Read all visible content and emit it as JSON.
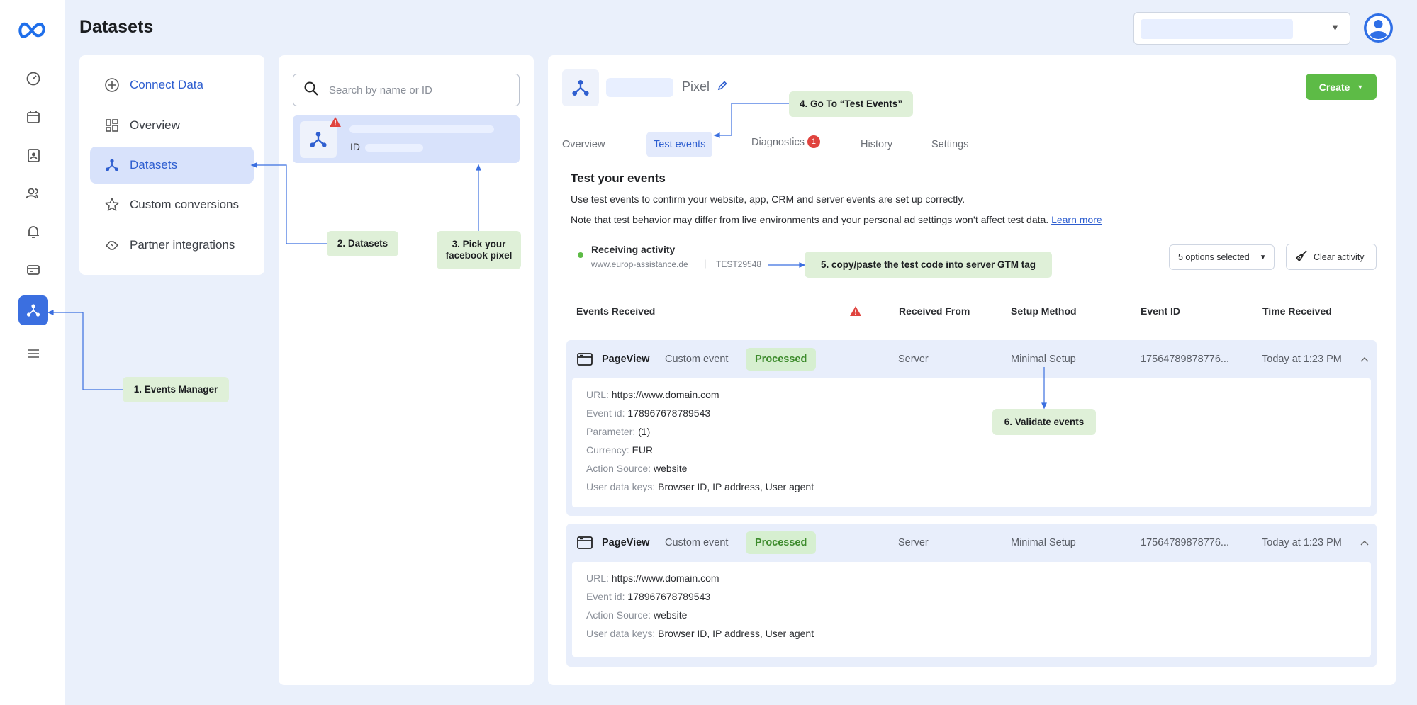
{
  "header": {
    "title": "Datasets"
  },
  "side_menu": {
    "items": [
      {
        "label": "Connect Data"
      },
      {
        "label": "Overview"
      },
      {
        "label": "Datasets"
      },
      {
        "label": "Custom conversions"
      },
      {
        "label": "Partner integrations"
      }
    ]
  },
  "middle": {
    "search_placeholder": "Search by name or ID",
    "pixel_item": {
      "id_label": "ID"
    }
  },
  "main": {
    "pixel_label": "Pixel",
    "create_label": "Create",
    "tabs": [
      {
        "label": "Overview"
      },
      {
        "label": "Test events"
      },
      {
        "label": "Diagnostics",
        "badge": "1"
      },
      {
        "label": "History"
      },
      {
        "label": "Settings"
      }
    ],
    "section_title": "Test your events",
    "desc1": "Use test events to confirm your website, app, CRM and server events are set up correctly.",
    "desc2": "Note that test behavior may differ from live environments and your  personal ad settings won’t affect test data.",
    "learn_more": "Learn more",
    "activity": {
      "status": "Receiving activity",
      "domain": "www.europ-assistance.de",
      "separator": "|",
      "test_code": "TEST29548"
    },
    "options_label": "5 options selected",
    "clear_label": "Clear activity",
    "table_headers": {
      "events_received": "Events Received",
      "received_from": "Received From",
      "setup_method": "Setup Method",
      "event_id": "Event ID",
      "time_received": "Time Received"
    },
    "events": [
      {
        "name": "PageView",
        "type": "Custom event",
        "status": "Processed",
        "from": "Server",
        "method": "Minimal Setup",
        "event_id": "17564789878776...",
        "time": "Today at 1:23 PM",
        "details": [
          {
            "key": "URL:",
            "value": "https://www.domain.com"
          },
          {
            "key": "Event id:",
            "value": "178967678789543"
          },
          {
            "key": "Parameter:",
            "value": "(1)"
          },
          {
            "key": "Currency:",
            "value": "EUR"
          },
          {
            "key": "Action Source:",
            "value": "website"
          },
          {
            "key": "User data keys:",
            "value": "Browser ID, IP address, User agent"
          }
        ]
      },
      {
        "name": "PageView",
        "type": "Custom event",
        "status": "Processed",
        "from": "Server",
        "method": "Minimal Setup",
        "event_id": "17564789878776...",
        "time": "Today at 1:23 PM",
        "details": [
          {
            "key": "URL:",
            "value": "https://www.domain.com"
          },
          {
            "key": "Event id:",
            "value": "178967678789543"
          },
          {
            "key": "Action Source:",
            "value": "website"
          },
          {
            "key": "User data keys:",
            "value": "Browser ID, IP address, User agent"
          }
        ]
      }
    ]
  },
  "annotations": {
    "n1": "1. Events Manager",
    "n2": "2. Datasets",
    "n3a": "3. Pick your",
    "n3b": "facebook pixel",
    "n4": "4. Go To “Test Events”",
    "n5": "5. copy/paste the test code into server GTM tag",
    "n6": "6. Validate events"
  },
  "colors": {
    "accent": "#3b6fe0",
    "link": "#2f5fd0",
    "create": "#5dbb46",
    "annotation_bg": "#dff0d8",
    "alert": "#e0433e"
  }
}
